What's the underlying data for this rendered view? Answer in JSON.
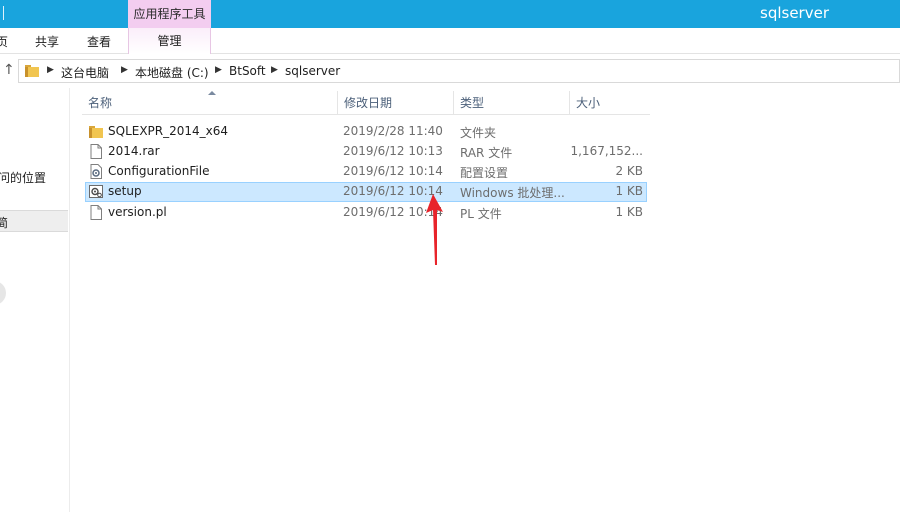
{
  "window": {
    "title": "sqlserver",
    "context_tool_group": "应用程序工具"
  },
  "ribbon": {
    "tabs": [
      {
        "label": "页"
      },
      {
        "label": "共享"
      },
      {
        "label": "查看"
      },
      {
        "label": "管理"
      }
    ]
  },
  "address_bar": {
    "breadcrumbs": [
      "这台电脑",
      "本地磁盘 (C:)",
      "BtSoft",
      "sqlserver"
    ]
  },
  "nav_pane": {
    "partial_item": "问的位置",
    "selected_partial": "简"
  },
  "columns": {
    "name": "名称",
    "modified": "修改日期",
    "type": "类型",
    "size": "大小"
  },
  "files": [
    {
      "name": "SQLEXPR_2014_x64",
      "modified": "2019/2/28 11:40",
      "type": "文件夹",
      "size": "",
      "icon": "folder-icon"
    },
    {
      "name": "2014.rar",
      "modified": "2019/6/12 10:13",
      "type": "RAR 文件",
      "size": "1,167,152...",
      "icon": "file-icon"
    },
    {
      "name": "ConfigurationFile",
      "modified": "2019/6/12 10:14",
      "type": "配置设置",
      "size": "2 KB",
      "icon": "config-file-icon"
    },
    {
      "name": "setup",
      "modified": "2019/6/12 10:14",
      "type": "Windows 批处理...",
      "size": "1 KB",
      "icon": "batch-file-icon"
    },
    {
      "name": "version.pl",
      "modified": "2019/6/12 10:14",
      "type": "PL 文件",
      "size": "1 KB",
      "icon": "file-icon"
    }
  ],
  "selected_row": 3,
  "colors": {
    "titlebar": "#19a4dd",
    "context_tab": "#f3cdf0",
    "selection": "#cce8ff",
    "annotation_arrow": "#e8242b"
  }
}
